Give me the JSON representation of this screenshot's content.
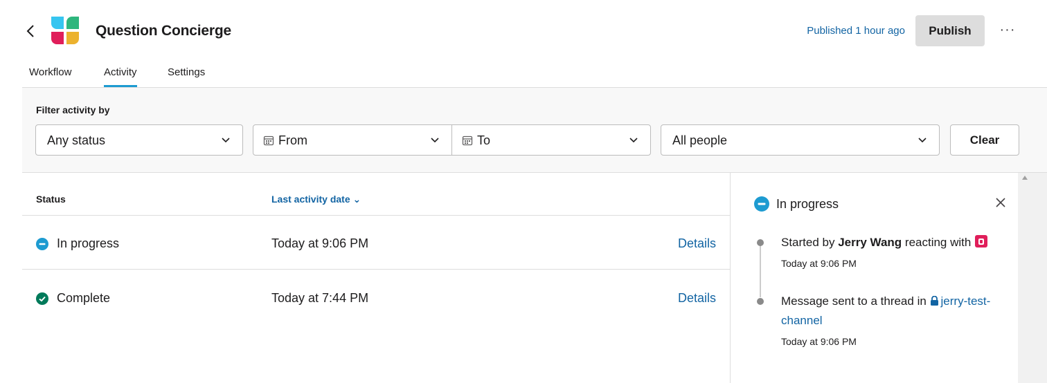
{
  "header": {
    "title": "Question Concierge",
    "published": "Published 1 hour ago",
    "publish_label": "Publish",
    "more_label": "···"
  },
  "tabs": [
    {
      "label": "Workflow",
      "active": false
    },
    {
      "label": "Activity",
      "active": true
    },
    {
      "label": "Settings",
      "active": false
    }
  ],
  "filter": {
    "label": "Filter activity by",
    "status_value": "Any status",
    "from_value": "From",
    "to_value": "To",
    "people_value": "All people",
    "clear_label": "Clear"
  },
  "table": {
    "columns": [
      "Status",
      "Last activity date ⌄"
    ],
    "rows": [
      {
        "status": "In progress",
        "date": "Today at 9:06 PM",
        "details": "Details"
      },
      {
        "status": "Complete",
        "date": "Today at 7:44 PM",
        "details": "Details"
      }
    ]
  },
  "panel": {
    "status": "In progress",
    "events": [
      {
        "text_before": "Started by ",
        "person": "Jerry Wang",
        "text_after": " reacting with ",
        "time": "Today at 9:06 PM"
      },
      {
        "text_before": "Message sent to a thread in ",
        "channel": "jerry-test-channel",
        "time": "Today at 9:06 PM"
      }
    ]
  },
  "colors": {
    "link": "#1264a3",
    "in_progress": "#1d9bd1",
    "complete": "#007a5a",
    "logo_teal": "#2eb67d",
    "logo_blue": "#36c5f0",
    "logo_red": "#e01e5a",
    "logo_yellow": "#ecb22e"
  }
}
